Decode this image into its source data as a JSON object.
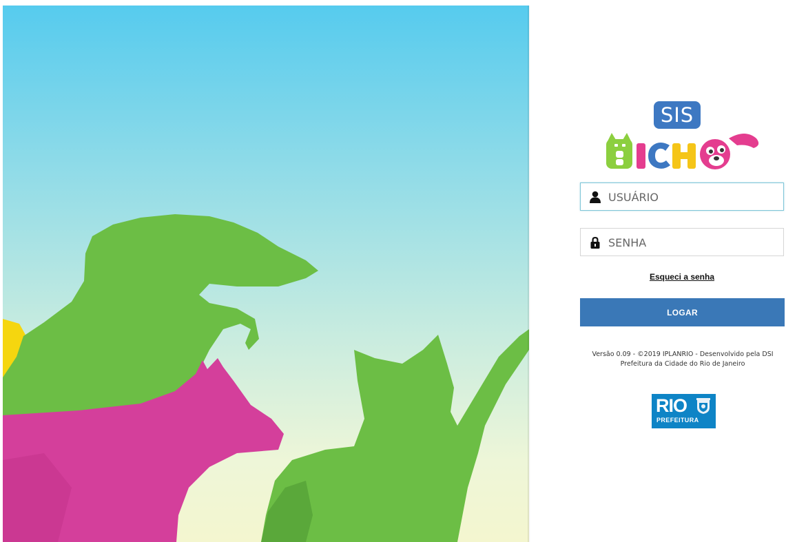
{
  "logo": {
    "top_text": "SIS",
    "bottom_text": "BICHO"
  },
  "login": {
    "username_placeholder": "USUÁRIO",
    "password_placeholder": "SENHA",
    "forgot_link": "Esqueci a senha",
    "submit_label": "LOGAR"
  },
  "footer": {
    "line1": "Versão 0.09 - ©2019 IPLANRIO - Desenvolvido pela DSI",
    "line2": "Prefeitura da Cidade do Rio de Janeiro"
  },
  "rio_logo": {
    "word": "RIO",
    "sub": "PREFEITURA"
  },
  "icons": {
    "user": "user-icon",
    "lock": "lock-icon",
    "crest": "crest-icon"
  },
  "colors": {
    "primary_button": "#3a78b7",
    "sis_badge": "#3d78c2",
    "rio_blue": "#0e84c6",
    "green": "#6cbe45",
    "magenta": "#d43f9b",
    "yellow": "#f5d60f",
    "sky": "#56cbee"
  }
}
